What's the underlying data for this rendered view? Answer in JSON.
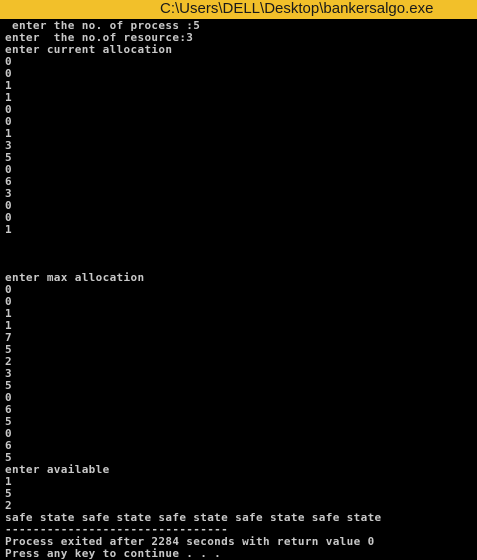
{
  "window": {
    "title": "C:\\Users\\DELL\\Desktop\\bankersalgo.exe",
    "titlebar_color": "#f2c02a",
    "console_background": "#000000",
    "console_text_color": "#c8c8c8"
  },
  "console": {
    "lines": [
      " enter the no. of process :5",
      "enter  the no.of resource:3",
      "enter current allocation",
      "0",
      "0",
      "1",
      "1",
      "0",
      "0",
      "1",
      "3",
      "5",
      "0",
      "6",
      "3",
      "0",
      "0",
      "1",
      "",
      "",
      "",
      "enter max allocation",
      "0",
      "0",
      "1",
      "1",
      "7",
      "5",
      "2",
      "3",
      "5",
      "0",
      "6",
      "5",
      "0",
      "6",
      "5",
      "enter available",
      "1",
      "5",
      "2",
      "safe state safe state safe state safe state safe state",
      "--------------------------------",
      "Process exited after 2284 seconds with return value 0",
      "Press any key to continue . . ."
    ]
  }
}
